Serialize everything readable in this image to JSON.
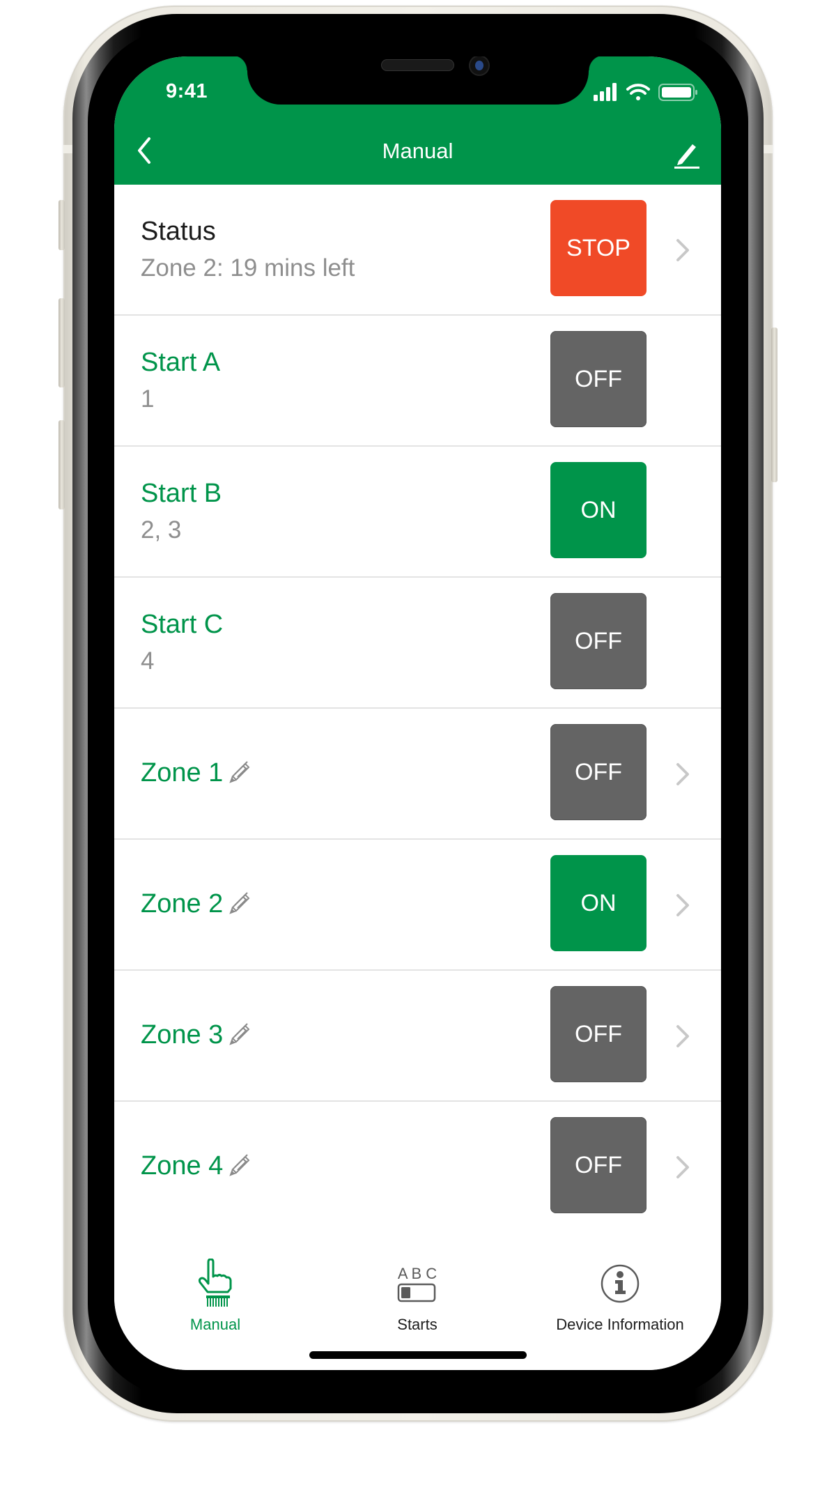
{
  "status_bar": {
    "time": "9:41",
    "signal_icon": "cellular-signal-icon",
    "wifi_icon": "wifi-icon",
    "battery_icon": "battery-icon"
  },
  "nav": {
    "title": "Manual",
    "back_icon": "chevron-left-icon",
    "edit_icon": "pencil-edit-icon"
  },
  "colors": {
    "brand_green": "#00944a",
    "stop_red": "#f04a27",
    "off_gray": "#646464",
    "subtitle_gray": "#8e8e8e",
    "divider": "#e3e3e3"
  },
  "status_row": {
    "title": "Status",
    "subtitle": "Zone 2:  19 mins left",
    "button_label": "STOP",
    "has_chevron": true
  },
  "starts": [
    {
      "title": "Start A",
      "subtitle": "1",
      "state": "OFF"
    },
    {
      "title": "Start B",
      "subtitle": "2, 3",
      "state": "ON"
    },
    {
      "title": "Start C",
      "subtitle": "4",
      "state": "OFF"
    }
  ],
  "zones": [
    {
      "title": "Zone 1",
      "state": "OFF",
      "editable": true,
      "has_chevron": true
    },
    {
      "title": "Zone 2",
      "state": "ON",
      "editable": true,
      "has_chevron": true
    },
    {
      "title": "Zone 3",
      "state": "OFF",
      "editable": true,
      "has_chevron": true
    },
    {
      "title": "Zone 4",
      "state": "OFF",
      "editable": true,
      "has_chevron": true
    }
  ],
  "tabs": [
    {
      "label": "Manual",
      "icon": "hand-pointer-icon",
      "active": true
    },
    {
      "label": "Starts",
      "icon": "abc-toggle-icon",
      "icon_text": "A B C",
      "active": false
    },
    {
      "label": "Device Information",
      "icon": "info-circle-icon",
      "active": false
    }
  ]
}
